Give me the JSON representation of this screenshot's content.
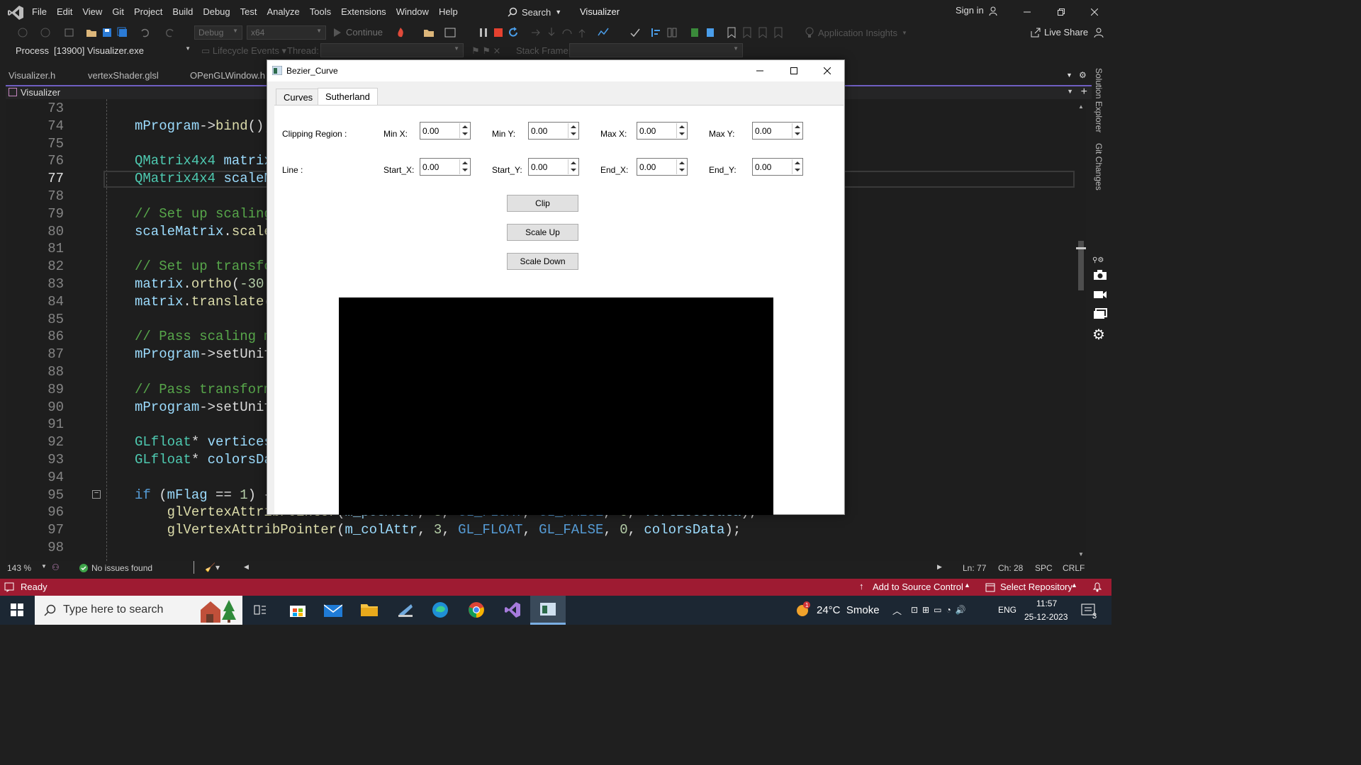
{
  "menubar": {
    "items": [
      "File",
      "Edit",
      "View",
      "Git",
      "Project",
      "Build",
      "Debug",
      "Test",
      "Analyze",
      "Tools",
      "Extensions",
      "Window",
      "Help"
    ],
    "search_label": "Search",
    "app_title": "Visualizer",
    "signin": "Sign in"
  },
  "toolbar": {
    "config": "Debug",
    "platform": "x64",
    "continue_label": "Continue",
    "insights": "Application Insights",
    "live_share": "Live Share"
  },
  "processbar": {
    "process_label": "Process:",
    "process_value": "[13900] Visualizer.exe",
    "lifecycle": "Lifecycle Events",
    "thread_label": "Thread:",
    "stack_label": "Stack Frame:"
  },
  "tabs": [
    "Visualizer.h",
    "vertexShader.glsl",
    "OPenGLWindow.h"
  ],
  "doc_header": "Visualizer",
  "side_panels": [
    "Solution Explorer",
    "Git Changes"
  ],
  "editor": {
    "lines": [
      {
        "n": "73",
        "code": ""
      },
      {
        "n": "74",
        "code": "mProgram->bind();"
      },
      {
        "n": "75",
        "code": ""
      },
      {
        "n": "76",
        "code": "QMatrix4x4 matrix"
      },
      {
        "n": "77",
        "code": "QMatrix4x4 scaleM"
      },
      {
        "n": "78",
        "code": ""
      },
      {
        "n": "79",
        "code": "// Set up scaling"
      },
      {
        "n": "80",
        "code": "scaleMatrix.scale"
      },
      {
        "n": "81",
        "code": ""
      },
      {
        "n": "82",
        "code": "// Set up transfo"
      },
      {
        "n": "83",
        "code": "matrix.ortho(-30."
      },
      {
        "n": "84",
        "code": "matrix.translate("
      },
      {
        "n": "85",
        "code": ""
      },
      {
        "n": "86",
        "code": "// Pass scaling m"
      },
      {
        "n": "87",
        "code": "mProgram->setUnif"
      },
      {
        "n": "88",
        "code": ""
      },
      {
        "n": "89",
        "code": "// Pass transform"
      },
      {
        "n": "90",
        "code": "mProgram->setUnif"
      },
      {
        "n": "91",
        "code": ""
      },
      {
        "n": "92",
        "code": "GLfloat* vertices"
      },
      {
        "n": "93",
        "code": "GLfloat* colorsDa"
      },
      {
        "n": "94",
        "code": ""
      },
      {
        "n": "95",
        "code": "if (mFlag == 1) {"
      },
      {
        "n": "96",
        "code": "    glVertexAttribPointer(m_posAttr, 3, GL_FLOAT, GL_FALSE, 0, verticesData);"
      },
      {
        "n": "97",
        "code": "    glVertexAttribPointer(m_colAttr, 3, GL_FLOAT, GL_FALSE, 0, colorsData);"
      },
      {
        "n": "98",
        "code": ""
      }
    ]
  },
  "editor_status": {
    "zoom": "143 %",
    "issues": "No issues found",
    "ln": "Ln: 77",
    "ch": "Ch: 28",
    "spc": "SPC",
    "crlf": "CRLF"
  },
  "statusbar": {
    "ready": "Ready",
    "source_control": "Add to Source Control",
    "repo": "Select Repository"
  },
  "taskbar": {
    "search_placeholder": "Type here to search",
    "weather": "24°C  Smoke",
    "lang": "ENG",
    "time": "11:57",
    "date": "25-12-2023",
    "notif_count": "3"
  },
  "qt_window": {
    "title": "Bezier_Curve",
    "tabs": [
      "Curves",
      "Sutherland"
    ],
    "active_tab": "Sutherland",
    "clipping_label": "Clipping Region :",
    "line_label": "Line :",
    "fields_row1": [
      {
        "label": "Min X:",
        "value": "0.00"
      },
      {
        "label": "Min Y:",
        "value": "0.00"
      },
      {
        "label": "Max X:",
        "value": "0.00"
      },
      {
        "label": "Max Y:",
        "value": "0.00"
      }
    ],
    "fields_row2": [
      {
        "label": "Start_X:",
        "value": "0.00"
      },
      {
        "label": "Start_Y:",
        "value": "0.00"
      },
      {
        "label": "End_X:",
        "value": "0.00"
      },
      {
        "label": "End_Y:",
        "value": "0.00"
      }
    ],
    "buttons": {
      "clip": "Clip",
      "scale_up": "Scale Up",
      "scale_down": "Scale Down"
    }
  }
}
